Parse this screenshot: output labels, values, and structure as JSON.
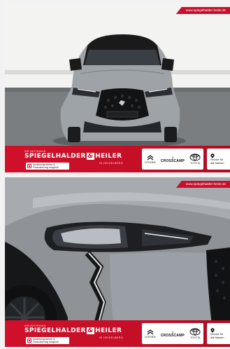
{
  "panels": [
    {
      "id": "panel1",
      "url_badge": "www.spiegelhalder-heiler.de",
      "dealer": {
        "tagline": "IHR AUTOHAUS",
        "name_part1": "SPIEGELHALDER",
        "amp": "&",
        "name_part2": "HEILER",
        "sub": "IN HEIDELBERG"
      },
      "finance_text": "Inzahlungnahme &\nFinanzierung möglich!",
      "brands": {
        "citroen": "CITROËN",
        "crosscamp_icon": "[]",
        "crosscamp": "CROSSCAMP",
        "toyota": "TOYOTA"
      },
      "service": "Service für\nalle Marken",
      "plate_text": "DS CITROËN BROTHERS"
    },
    {
      "id": "panel2",
      "url_badge": "www.spiegelhalder-heiler.de",
      "dealer": {
        "tagline": "IHR AUTOHAUS",
        "name_part1": "SPIEGELHALDER",
        "amp": "&",
        "name_part2": "HEILER",
        "sub": "IN HEIDELBERG"
      },
      "finance_text": "Inzahlungnahme &\nFinanzierung möglich!",
      "brands": {
        "citroen": "CITROËN",
        "crosscamp_icon": "[]",
        "crosscamp": "CROSSCAMP",
        "toyota": "TOYOTA"
      },
      "service": "Service für\nalle Marken"
    }
  ],
  "colors": {
    "brand_red": "#c8102e",
    "car_gray": "#9ea3a8",
    "roof_black": "#1a1a1a",
    "wall": "#f3f3f1",
    "ground": "#7b7e80"
  },
  "icons": [
    "pin-icon",
    "document-icon",
    "citroen-icon",
    "toyota-icon"
  ]
}
